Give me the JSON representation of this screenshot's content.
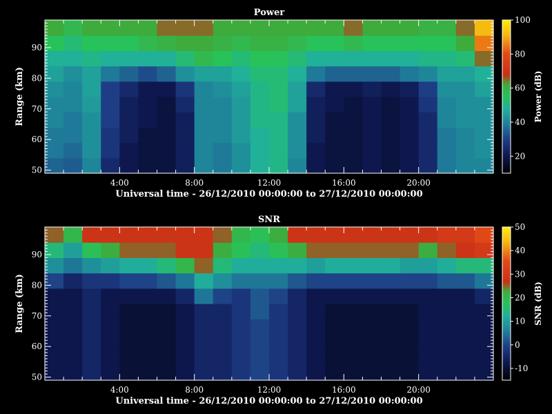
{
  "chart_data": [
    {
      "type": "heatmap",
      "title": "Power",
      "xlabel": "Universal time - 26/12/2010 00:00:00 to 27/12/2010 00:00:00",
      "ylabel": "Range (km)",
      "x_unit": "hours UT",
      "xlim": [
        0,
        24
      ],
      "ylim": [
        49,
        99
      ],
      "x_ticks": [
        4,
        8,
        12,
        16,
        20
      ],
      "x_tick_labels": [
        "4:00",
        "8:00",
        "12:00",
        "16:00",
        "20:00"
      ],
      "y_ticks": [
        50,
        60,
        70,
        80,
        90
      ],
      "y_tick_labels": [
        "50",
        "60",
        "70",
        "80",
        "90"
      ],
      "colorbar": {
        "label": "Power (dB)",
        "range": [
          10,
          100
        ],
        "ticks": [
          20,
          40,
          60,
          80,
          100
        ],
        "tick_labels": [
          "20",
          "40",
          "60",
          "80",
          "100"
        ]
      },
      "value_range": [
        10,
        100
      ],
      "time_hours": [
        0.5,
        1.5,
        2.5,
        3.5,
        4.5,
        5.5,
        6.5,
        7.5,
        8.5,
        9.5,
        10.5,
        11.5,
        12.5,
        13.5,
        14.5,
        15.5,
        16.5,
        17.5,
        18.5,
        19.5,
        20.5,
        21.5,
        22.5,
        23.5
      ],
      "range_km": [
        51,
        56,
        61,
        66,
        71,
        76,
        81,
        86,
        91,
        96
      ],
      "values": [
        [
          35,
          34,
          40,
          25,
          20,
          18,
          18,
          22,
          40,
          38,
          42,
          48,
          50,
          40,
          20,
          18,
          18,
          20,
          18,
          20,
          25,
          38,
          40,
          40
        ],
        [
          38,
          36,
          42,
          28,
          20,
          18,
          18,
          22,
          40,
          38,
          42,
          48,
          50,
          42,
          20,
          18,
          18,
          20,
          18,
          20,
          25,
          38,
          40,
          42
        ],
        [
          38,
          38,
          42,
          28,
          22,
          18,
          18,
          22,
          40,
          40,
          44,
          48,
          50,
          42,
          22,
          18,
          18,
          20,
          18,
          20,
          25,
          38,
          40,
          42
        ],
        [
          40,
          38,
          42,
          30,
          22,
          20,
          18,
          22,
          40,
          40,
          44,
          50,
          50,
          42,
          22,
          18,
          18,
          20,
          18,
          20,
          25,
          40,
          42,
          42
        ],
        [
          40,
          40,
          44,
          30,
          22,
          20,
          18,
          25,
          40,
          40,
          44,
          50,
          52,
          45,
          22,
          20,
          18,
          20,
          18,
          20,
          28,
          40,
          42,
          42
        ],
        [
          42,
          40,
          45,
          30,
          25,
          20,
          20,
          28,
          40,
          42,
          45,
          50,
          52,
          45,
          25,
          20,
          20,
          22,
          20,
          22,
          30,
          42,
          42,
          45
        ],
        [
          45,
          42,
          45,
          38,
          35,
          32,
          35,
          42,
          45,
          45,
          48,
          52,
          52,
          48,
          38,
          35,
          35,
          35,
          35,
          38,
          40,
          45,
          45,
          48
        ],
        [
          48,
          48,
          50,
          48,
          48,
          48,
          48,
          52,
          58,
          55,
          52,
          55,
          55,
          52,
          48,
          48,
          48,
          48,
          48,
          48,
          50,
          50,
          52,
          65
        ],
        [
          55,
          52,
          55,
          55,
          55,
          58,
          60,
          62,
          62,
          60,
          58,
          60,
          60,
          58,
          55,
          55,
          58,
          55,
          55,
          55,
          55,
          55,
          62,
          85
        ],
        [
          62,
          58,
          62,
          62,
          62,
          62,
          65,
          65,
          65,
          62,
          62,
          62,
          62,
          62,
          62,
          62,
          65,
          62,
          62,
          62,
          60,
          60,
          65,
          92
        ]
      ]
    },
    {
      "type": "heatmap",
      "title": "SNR",
      "xlabel": "Universal time - 26/12/2010 00:00:00 to 27/12/2010 00:00:00",
      "ylabel": "Range (km)",
      "x_unit": "hours UT",
      "xlim": [
        0,
        24
      ],
      "ylim": [
        49,
        99
      ],
      "x_ticks": [
        4,
        8,
        12,
        16,
        20
      ],
      "x_tick_labels": [
        "4:00",
        "8:00",
        "12:00",
        "16:00",
        "20:00"
      ],
      "y_ticks": [
        50,
        60,
        70,
        80,
        90
      ],
      "y_tick_labels": [
        "50",
        "60",
        "70",
        "80",
        "90"
      ],
      "colorbar": {
        "label": "SNR (dB)",
        "range": [
          -15,
          50
        ],
        "ticks": [
          -10,
          0,
          10,
          20,
          30,
          40,
          50
        ],
        "tick_labels": [
          "-10",
          "0",
          "10",
          "20",
          "30",
          "40",
          "50"
        ]
      },
      "value_range": [
        -15,
        50
      ],
      "time_hours": [
        0.5,
        1.5,
        2.5,
        3.5,
        4.5,
        5.5,
        6.5,
        7.5,
        8.5,
        9.5,
        10.5,
        11.5,
        12.5,
        13.5,
        14.5,
        15.5,
        16.5,
        17.5,
        18.5,
        19.5,
        20.5,
        21.5,
        22.5,
        23.5
      ],
      "range_km": [
        51,
        56,
        61,
        66,
        71,
        76,
        81,
        86,
        91,
        96
      ],
      "values": [
        [
          -8,
          -8,
          -5,
          -8,
          -10,
          -10,
          -10,
          -8,
          -5,
          -5,
          -2,
          0,
          -2,
          -5,
          -8,
          -10,
          -10,
          -10,
          -10,
          -10,
          -8,
          -8,
          -8,
          -8
        ],
        [
          -8,
          -8,
          -5,
          -8,
          -10,
          -10,
          -10,
          -8,
          -5,
          -5,
          -2,
          0,
          -2,
          -5,
          -8,
          -10,
          -10,
          -10,
          -10,
          -10,
          -8,
          -8,
          -8,
          -8
        ],
        [
          -8,
          -8,
          -5,
          -8,
          -10,
          -10,
          -10,
          -8,
          -5,
          -5,
          -2,
          0,
          -2,
          -5,
          -8,
          -10,
          -10,
          -10,
          -10,
          -10,
          -8,
          -8,
          -8,
          -8
        ],
        [
          -8,
          -8,
          -5,
          -8,
          -10,
          -10,
          -10,
          -8,
          -5,
          -5,
          -2,
          0,
          -2,
          -5,
          -8,
          -10,
          -10,
          -10,
          -10,
          -10,
          -8,
          -8,
          -8,
          -8
        ],
        [
          -8,
          -8,
          -5,
          -8,
          -10,
          -10,
          -10,
          -8,
          -5,
          -5,
          -2,
          2,
          -2,
          -5,
          -8,
          -10,
          -10,
          -10,
          -10,
          -10,
          -8,
          -8,
          -8,
          -8
        ],
        [
          -8,
          -8,
          -5,
          -8,
          -8,
          -8,
          -8,
          -5,
          5,
          0,
          -2,
          2,
          0,
          -5,
          -8,
          -8,
          -8,
          -8,
          -8,
          -8,
          -8,
          -8,
          -8,
          -5
        ],
        [
          0,
          -5,
          -2,
          -2,
          0,
          0,
          2,
          5,
          12,
          8,
          5,
          5,
          5,
          2,
          0,
          0,
          0,
          0,
          0,
          0,
          0,
          2,
          2,
          5
        ],
        [
          8,
          5,
          8,
          10,
          12,
          12,
          15,
          20,
          25,
          15,
          12,
          12,
          12,
          12,
          10,
          12,
          12,
          12,
          12,
          10,
          10,
          12,
          15,
          15
        ],
        [
          15,
          10,
          18,
          22,
          25,
          25,
          25,
          28,
          28,
          22,
          18,
          15,
          18,
          22,
          25,
          25,
          25,
          25,
          25,
          25,
          22,
          25,
          28,
          30
        ],
        [
          25,
          20,
          28,
          28,
          28,
          28,
          28,
          28,
          28,
          25,
          20,
          18,
          22,
          28,
          28,
          28,
          28,
          28,
          28,
          28,
          28,
          30,
          30,
          35
        ]
      ]
    }
  ]
}
